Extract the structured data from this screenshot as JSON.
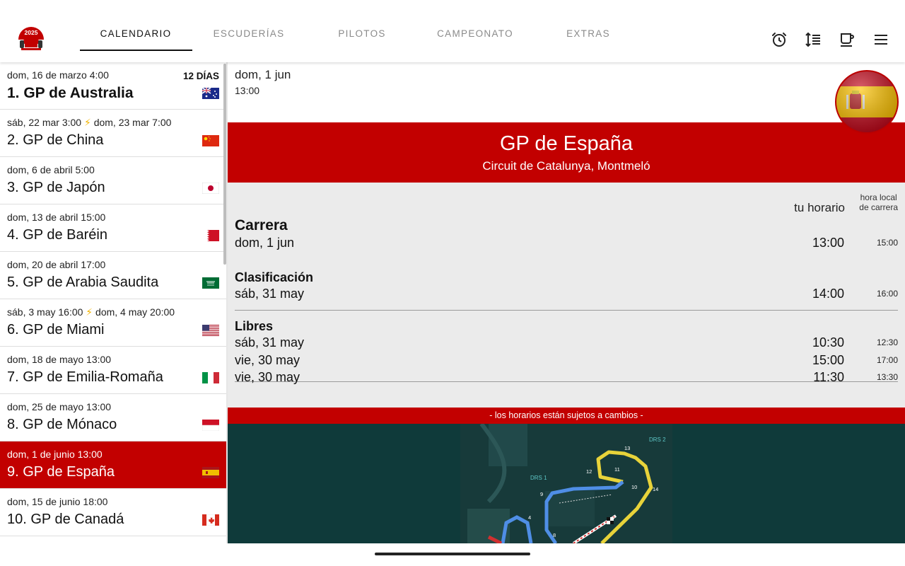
{
  "app": {
    "logo_year": "2025",
    "tabs": [
      {
        "label": "CALENDARIO",
        "active": true
      },
      {
        "label": "ESCUDERÍAS",
        "active": false
      },
      {
        "label": "PILOTOS",
        "active": false
      },
      {
        "label": "CAMPEONATO",
        "active": false
      },
      {
        "label": "EXTRAS",
        "active": false
      }
    ],
    "actions": [
      "alarm-icon",
      "sort-lines-icon",
      "coffee-cup-icon",
      "menu-icon"
    ]
  },
  "calendar": {
    "races": [
      {
        "date": "dom, 16 de marzo 4:00",
        "name": "1. GP de Australia",
        "badge": "12 DÍAS",
        "flag": "australia"
      },
      {
        "date_a": "sáb, 22 mar 3:00",
        "date_b": "dom, 23 mar 7:00",
        "name": "2. GP de China",
        "flag": "china"
      },
      {
        "date": "dom, 6 de abril 5:00",
        "name": "3. GP de Japón",
        "flag": "japan"
      },
      {
        "date": "dom, 13 de abril 15:00",
        "name": "4. GP de Baréin",
        "flag": "bahrain"
      },
      {
        "date": "dom, 20 de abril 17:00",
        "name": "5. GP de Arabia Saudita",
        "flag": "saudi-arabia"
      },
      {
        "date_a": "sáb, 3 may 16:00",
        "date_b": "dom, 4 may 20:00",
        "name": "6. GP de Miami",
        "flag": "usa"
      },
      {
        "date": "dom, 18 de mayo 13:00",
        "name": "7. GP de Emilia-Romaña",
        "flag": "italy"
      },
      {
        "date": "dom, 25 de mayo 13:00",
        "name": "8. GP de Mónaco",
        "flag": "monaco"
      },
      {
        "date": "dom, 1 de junio 13:00",
        "name": "9. GP de España",
        "flag": "spain",
        "selected": true
      },
      {
        "date": "dom, 15 de junio 18:00",
        "name": "10. GP de Canadá",
        "flag": "canada"
      }
    ]
  },
  "detail": {
    "header_date": "dom, 1 jun",
    "header_time": "13:00",
    "flag": "spain",
    "title": "GP de España",
    "circuit": "Circuit de Catalunya, Montmeló",
    "col_tu": "tu horario",
    "col_local_1": "hora local",
    "col_local_2": "de carrera",
    "sessions": [
      {
        "name": "Carrera",
        "rows": [
          {
            "day": "dom, 1 jun",
            "tu": "13:00",
            "local": "15:00"
          }
        ]
      },
      {
        "name": "Clasificación",
        "rows": [
          {
            "day": "sáb, 31 may",
            "tu": "14:00",
            "local": "16:00"
          }
        ]
      },
      {
        "name": "Libres",
        "rows": [
          {
            "day": "sáb, 31 may",
            "tu": "10:30",
            "local": "12:30"
          },
          {
            "day": "vie, 30 may",
            "tu": "15:00",
            "local": "17:00"
          },
          {
            "day": "vie, 30 may",
            "tu": "11:30",
            "local": "13:30"
          }
        ]
      }
    ],
    "notice": "- los horarios están sujetos a cambios -",
    "map_labels": {
      "drs1": "DRS 1",
      "drs2": "DRS 2",
      "turns": [
        "4",
        "8",
        "9",
        "10",
        "11",
        "12",
        "13",
        "14"
      ]
    }
  },
  "colors": {
    "accent": "#c20000",
    "map_bg": "#0f3a3a",
    "drs_yellow": "#e8d33a",
    "drs_blue": "#4f8ee6"
  }
}
